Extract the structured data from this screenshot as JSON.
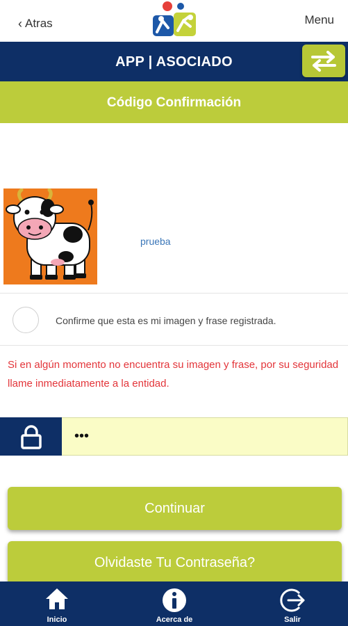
{
  "header": {
    "back_label": "Atras",
    "menu_label": "Menu",
    "title": "APP | ASOCIADO",
    "subtitle": "Código Confirmación"
  },
  "security": {
    "phrase": "prueba",
    "confirm_text": "Confirme que esta es mi imagen y frase registrada.",
    "warning": "Si en algún momento no encuentra su imagen y frase, por su seguridad llame inmediatamente a la entidad."
  },
  "password": {
    "value": "•••"
  },
  "buttons": {
    "continue_label": "Continuar",
    "forgot_label": "Olvidaste Tu Contraseña?"
  },
  "bottom_nav": {
    "items": [
      {
        "label": "Inicio",
        "icon": "home-icon"
      },
      {
        "label": "Acerca de",
        "icon": "info-icon"
      },
      {
        "label": "Salir",
        "icon": "logout-icon"
      }
    ]
  },
  "colors": {
    "navy": "#0e2f66",
    "lime": "#bccc3b",
    "warning_red": "#e3353a",
    "link_blue": "#3a76b8",
    "input_bg": "#fafcc6",
    "cow_bg": "#ee7a1d"
  }
}
